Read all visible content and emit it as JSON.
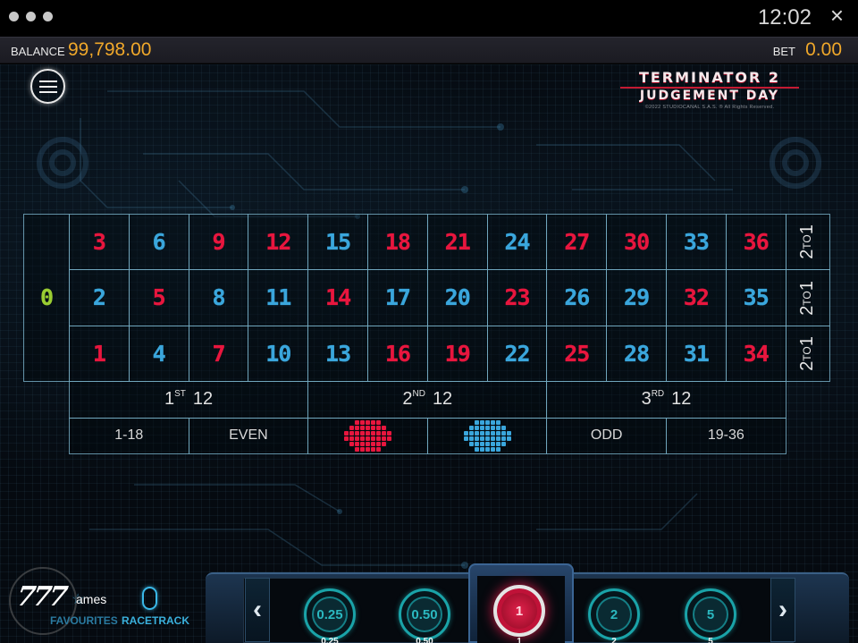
{
  "status_bar": {
    "time": "12:02",
    "close_icon": "×"
  },
  "balance_bar": {
    "balance_label": "BALANCE",
    "balance_value": "99,798.00",
    "bet_label": "BET",
    "bet_value": "0.00"
  },
  "logo": {
    "line1": "TERMINATOR 2",
    "line2": "JUDGEMENT DAY",
    "copyright": "©2022 STUDIOCANAL S.A.S. ® All Rights Reserved."
  },
  "colors": {
    "red": "#e8163e",
    "blue": "#3aa6dc",
    "green": "#9acd32",
    "gold": "#f0a82a"
  },
  "table": {
    "zero": {
      "label": "0",
      "color": "green"
    },
    "rows": [
      [
        {
          "n": "3",
          "c": "red"
        },
        {
          "n": "6",
          "c": "blue"
        },
        {
          "n": "9",
          "c": "red"
        },
        {
          "n": "12",
          "c": "red"
        },
        {
          "n": "15",
          "c": "blue"
        },
        {
          "n": "18",
          "c": "red"
        },
        {
          "n": "21",
          "c": "red"
        },
        {
          "n": "24",
          "c": "blue"
        },
        {
          "n": "27",
          "c": "red"
        },
        {
          "n": "30",
          "c": "red"
        },
        {
          "n": "33",
          "c": "blue"
        },
        {
          "n": "36",
          "c": "red"
        }
      ],
      [
        {
          "n": "2",
          "c": "blue"
        },
        {
          "n": "5",
          "c": "red"
        },
        {
          "n": "8",
          "c": "blue"
        },
        {
          "n": "11",
          "c": "blue"
        },
        {
          "n": "14",
          "c": "red"
        },
        {
          "n": "17",
          "c": "blue"
        },
        {
          "n": "20",
          "c": "blue"
        },
        {
          "n": "23",
          "c": "red"
        },
        {
          "n": "26",
          "c": "blue"
        },
        {
          "n": "29",
          "c": "blue"
        },
        {
          "n": "32",
          "c": "red"
        },
        {
          "n": "35",
          "c": "blue"
        }
      ],
      [
        {
          "n": "1",
          "c": "red"
        },
        {
          "n": "4",
          "c": "blue"
        },
        {
          "n": "7",
          "c": "red"
        },
        {
          "n": "10",
          "c": "blue"
        },
        {
          "n": "13",
          "c": "blue"
        },
        {
          "n": "16",
          "c": "red"
        },
        {
          "n": "19",
          "c": "red"
        },
        {
          "n": "22",
          "c": "blue"
        },
        {
          "n": "25",
          "c": "red"
        },
        {
          "n": "28",
          "c": "blue"
        },
        {
          "n": "31",
          "c": "blue"
        },
        {
          "n": "34",
          "c": "red"
        }
      ]
    ],
    "column_bets": [
      {
        "a": "2",
        "b": "TO",
        "c": "1"
      },
      {
        "a": "2",
        "b": "TO",
        "c": "1"
      },
      {
        "a": "2",
        "b": "TO",
        "c": "1"
      }
    ],
    "dozens": [
      {
        "num": "1",
        "sup": "ST",
        "label": "12"
      },
      {
        "num": "2",
        "sup": "ND",
        "label": "12"
      },
      {
        "num": "3",
        "sup": "RD",
        "label": "12"
      }
    ],
    "outside_bets": [
      "1-18",
      "EVEN",
      "red-diamond",
      "blue-diamond",
      "ODD",
      "19-36"
    ]
  },
  "bottom": {
    "brand_777": "777",
    "brand_text": "ames",
    "favourites_label": "FAVOURITES",
    "racetrack_label": "RACETRACK"
  },
  "chips": [
    {
      "value": "0.25",
      "label": "0.25",
      "selected": false
    },
    {
      "value": "0.50",
      "label": "0.50",
      "selected": false
    },
    {
      "value": "1",
      "label": "1",
      "selected": true
    },
    {
      "value": "2",
      "label": "2",
      "selected": false
    },
    {
      "value": "5",
      "label": "5",
      "selected": false
    }
  ]
}
